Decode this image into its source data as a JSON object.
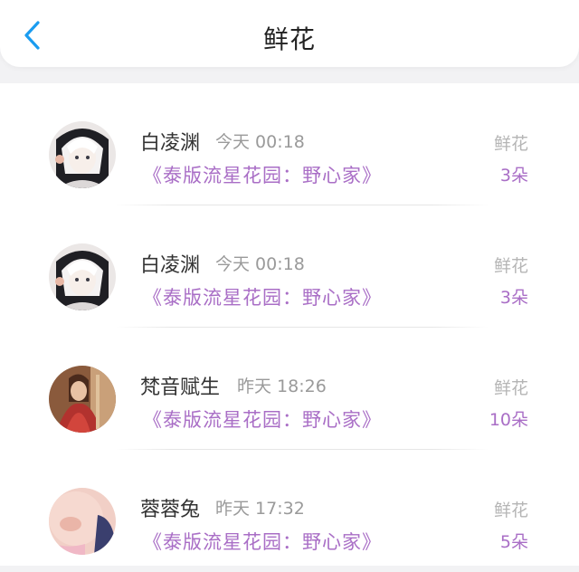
{
  "header": {
    "title": "鲜花",
    "back_icon": "chevron-left-icon",
    "accent": "#1a9cf0"
  },
  "items": [
    {
      "name": "白凌渊",
      "time": "今天 00:18",
      "series": "《泰版流星花园：野心家》",
      "gift": "鲜花",
      "count": "3朵"
    },
    {
      "name": "白凌渊",
      "time": "今天 00:18",
      "series": "《泰版流星花园：野心家》",
      "gift": "鲜花",
      "count": "3朵"
    },
    {
      "name": "梵音赋生",
      "time": "昨天 18:26",
      "series": "《泰版流星花园：野心家》",
      "gift": "鲜花",
      "count": "10朵"
    },
    {
      "name": "蓉蓉兔",
      "time": "昨天 17:32",
      "series": "《泰版流星花园：野心家》",
      "gift": "鲜花",
      "count": "5朵"
    }
  ],
  "colors": {
    "link": "#a96ec6",
    "muted": "#9a9a9a",
    "name": "#333333"
  }
}
